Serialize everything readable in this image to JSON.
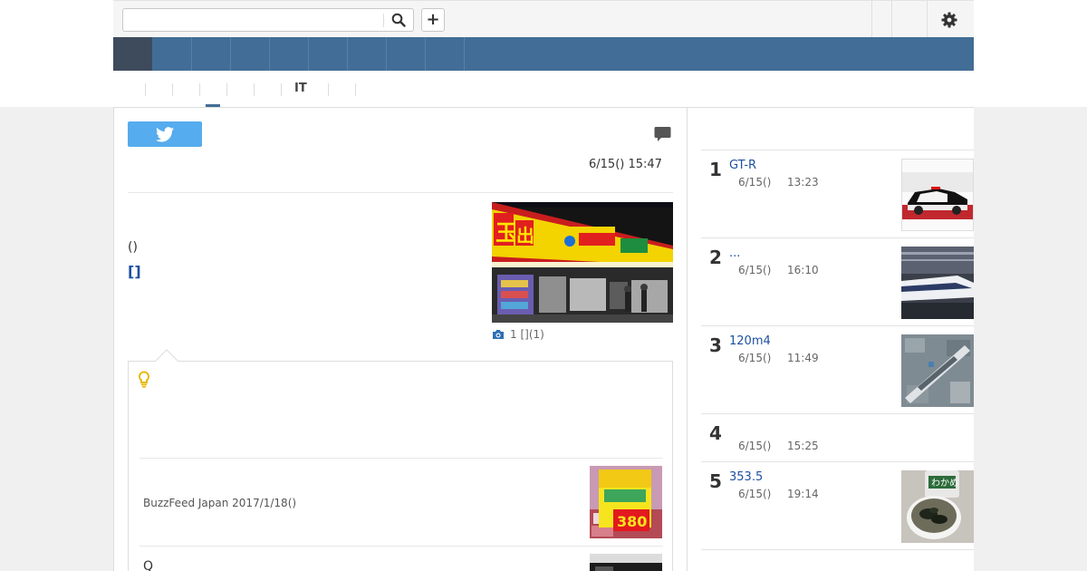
{
  "search": {
    "placeholder": ""
  },
  "toolbar": {
    "add_label": "+"
  },
  "subnav": {
    "it_label": "IT"
  },
  "article": {
    "datetime": "6/15() 15:47",
    "paren_text": "()",
    "link_text": "[]",
    "photo_caption": "1 [](1)"
  },
  "related": {
    "source": "BuzzFeed Japan 2017/1/18()",
    "second_title": "Q"
  },
  "ranking": [
    {
      "rank": "1",
      "title": "GT-R",
      "date": "6/15()",
      "time": "13:23",
      "thumb": "police-car"
    },
    {
      "rank": "2",
      "title": "...",
      "date": "6/15()",
      "time": "16:10",
      "thumb": "bullet-train"
    },
    {
      "rank": "3",
      "title": "120m4",
      "date": "6/15()",
      "time": "11:49",
      "thumb": "aerial-view"
    },
    {
      "rank": "4",
      "title": "",
      "date": "6/15()",
      "time": "15:25",
      "thumb": ""
    },
    {
      "rank": "5",
      "title": "353.5",
      "date": "6/15()",
      "time": "19:14",
      "thumb": "seaweed-cup"
    }
  ],
  "colors": {
    "nav": "#426d96",
    "nav_home": "#3e4b5c",
    "link": "#1e50a2",
    "twitter": "#55acee",
    "bulb": "#e8b800"
  }
}
